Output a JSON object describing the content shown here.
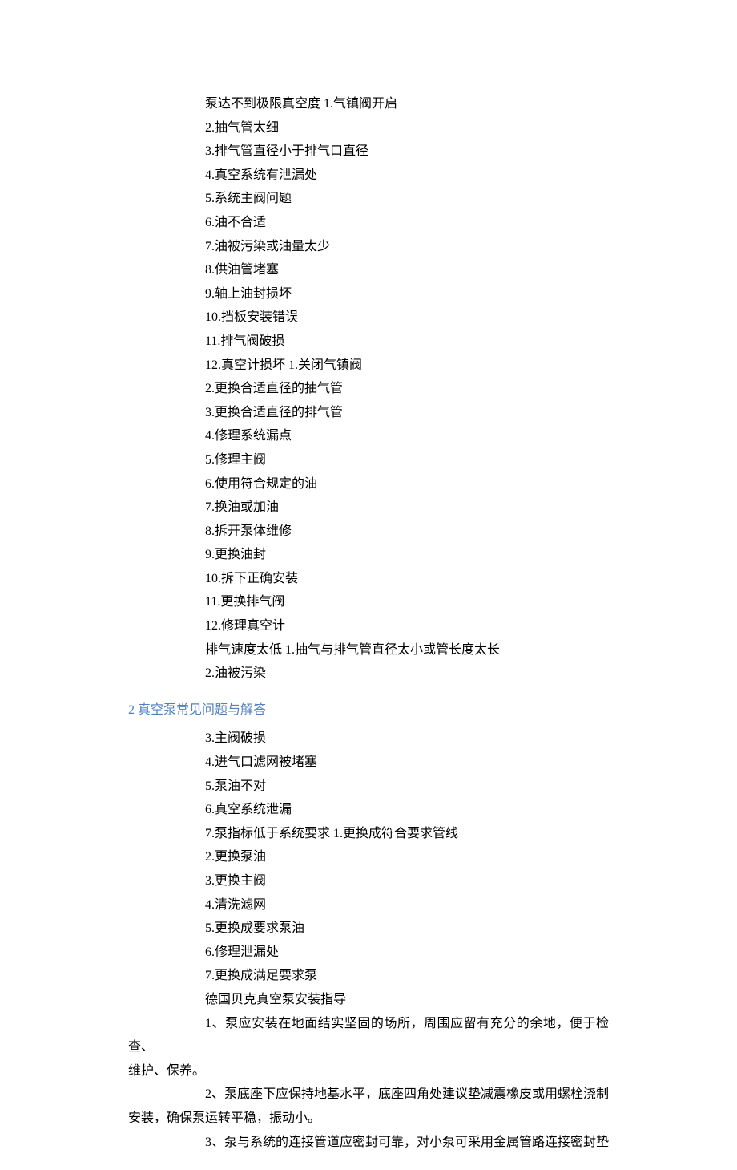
{
  "block1": {
    "lines": [
      "泵达不到极限真空度  1.气镇阀开启",
      "2.抽气管太细",
      "3.排气管直径小于排气口直径",
      "4.真空系统有泄漏处",
      "5.系统主阀问题",
      "6.油不合适",
      "7.油被污染或油量太少",
      "8.供油管堵塞",
      "9.轴上油封损坏",
      "10.挡板安装错误",
      "11.排气阀破损",
      "12.真空计损坏  1.关闭气镇阀",
      "2.更换合适直径的抽气管",
      "3.更换合适直径的排气管",
      "4.修理系统漏点",
      "5.修理主阀",
      "6.使用符合规定的油",
      "7.换油或加油",
      "8.拆开泵体维修",
      "9.更换油封",
      "10.拆下正确安装",
      "11.更换排气阀",
      "12.修理真空计",
      "排气速度太低  1.抽气与排气管直径太小或管长度太长",
      "2.油被污染"
    ]
  },
  "section_title": "2 真空泵常见问题与解答",
  "block2": {
    "lines": [
      "3.主阀破损",
      "4.进气口滤网被堵塞",
      "5.泵油不对",
      "6.真空系统泄漏",
      "7.泵指标低于系统要求  1.更换成符合要求管线",
      "2.更换泵油",
      "3.更换主阀",
      "4.清洗滤网",
      "5.更换成要求泵油",
      "6.修理泄漏处",
      "7.更换成满足要求泵",
      "德国贝克真空泵安装指导"
    ]
  },
  "paragraphs": [
    {
      "lead": "1、泵应安装在地面结实坚固的场所，周围应留有充分的余地，便于检查、",
      "cont": "维护、保养。"
    },
    {
      "lead": "2、泵底座下应保持地基水平，底座四角处建议垫减震橡皮或用螺栓浇制",
      "cont": "安装，确保泵运转平稳，振动小。"
    },
    {
      "lead": "3、泵与系统的连接管道应密封可靠，对小泵可采用金属管路连接密封垫",
      "cont": ""
    }
  ]
}
